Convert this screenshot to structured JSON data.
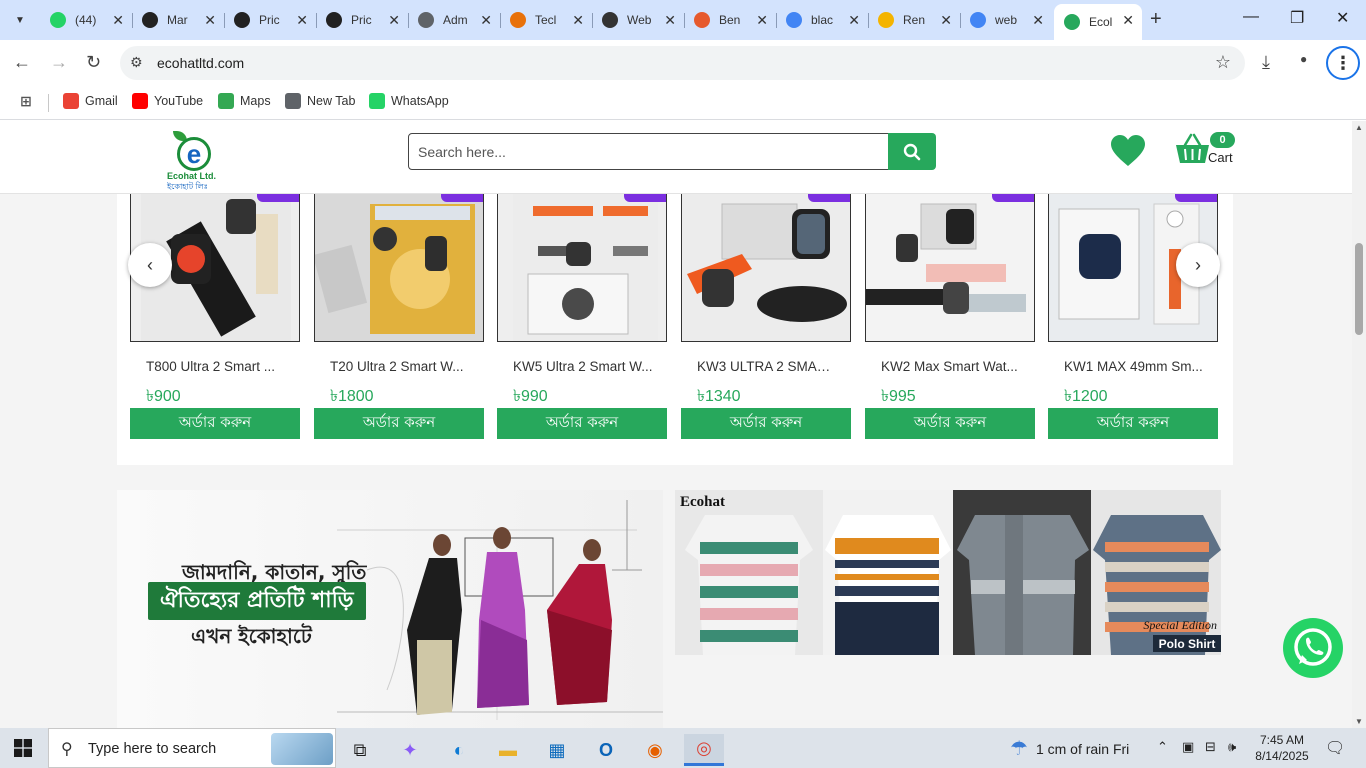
{
  "browser": {
    "tabs": [
      {
        "title": "(44)",
        "icon": "whatsapp-icon",
        "color": "#25d366"
      },
      {
        "title": "Mar",
        "icon": "triangle-logo-icon",
        "color": "#222222"
      },
      {
        "title": "Pric",
        "icon": "triangle-logo-icon",
        "color": "#222222"
      },
      {
        "title": "Pric",
        "icon": "triangle-logo-icon",
        "color": "#222222"
      },
      {
        "title": "Adm",
        "icon": "globe-icon",
        "color": "#5f6368"
      },
      {
        "title": "Tecl",
        "icon": "multicolor-icon",
        "color": "#e8710a"
      },
      {
        "title": "Web",
        "icon": "openai-icon",
        "color": "#333333"
      },
      {
        "title": "Ben",
        "icon": "bengali-site-icon",
        "color": "#e65a2e"
      },
      {
        "title": "blac",
        "icon": "google-icon",
        "color": "#4285f4"
      },
      {
        "title": "Ren",
        "icon": "book-icon",
        "color": "#f4b400"
      },
      {
        "title": "web",
        "icon": "google-icon",
        "color": "#4285f4"
      },
      {
        "title": "Ecol",
        "icon": "ecohat-icon",
        "color": "#27a85c",
        "active": true
      }
    ],
    "url": "ecohatltd.com",
    "bookmarks": [
      {
        "label": "Gmail",
        "icon": "gmail-icon",
        "color": "#ea4335"
      },
      {
        "label": "YouTube",
        "icon": "youtube-icon",
        "color": "#ff0000"
      },
      {
        "label": "Maps",
        "icon": "maps-icon",
        "color": "#34a853"
      },
      {
        "label": "New Tab",
        "icon": "globe-icon",
        "color": "#5f6368"
      },
      {
        "label": "WhatsApp",
        "icon": "whatsapp-icon",
        "color": "#25d366"
      }
    ]
  },
  "site": {
    "logo_title": "Ecohat Ltd.",
    "logo_bangla": "ইকোহাট লিঃ",
    "search_placeholder": "Search here...",
    "cart_count": "0",
    "cart_label": "Cart",
    "accent_color": "#27a85c"
  },
  "products": [
    {
      "name": "T800 Ultra 2 Smart ...",
      "price": "৳900",
      "order_label": "অর্ডার করুন"
    },
    {
      "name": "T20 Ultra 2 Smart W...",
      "price": "৳1800",
      "order_label": "অর্ডার করুন"
    },
    {
      "name": "KW5 Ultra 2 Smart W...",
      "price": "৳990",
      "order_label": "অর্ডার করুন"
    },
    {
      "name": "KW3 ULTRA 2 SMAR...",
      "price": "৳1340",
      "order_label": "অর্ডার করুন"
    },
    {
      "name": "KW2 Max Smart Wat...",
      "price": "৳995",
      "order_label": "অর্ডার করুন"
    },
    {
      "name": "KW1 MAX 49mm Sm...",
      "price": "৳1200",
      "order_label": "অর্ডার করুন"
    }
  ],
  "carousel": {
    "prev": "‹",
    "next": "›"
  },
  "banners": {
    "saree": {
      "line1": "জামদানি, কাতান, সুতি",
      "line2": "ঐতিহ্যের প্রতিটি শাড়ি",
      "line3": "এখন ইকোহাটে"
    },
    "polo": {
      "brand": "Ecohat",
      "edition": "Special Edition",
      "tag": "Polo Shirt"
    }
  },
  "taskbar": {
    "search_placeholder": "Type here to search",
    "weather": "1 cm of rain Fri",
    "time": "7:45 AM",
    "date": "8/14/2025"
  }
}
